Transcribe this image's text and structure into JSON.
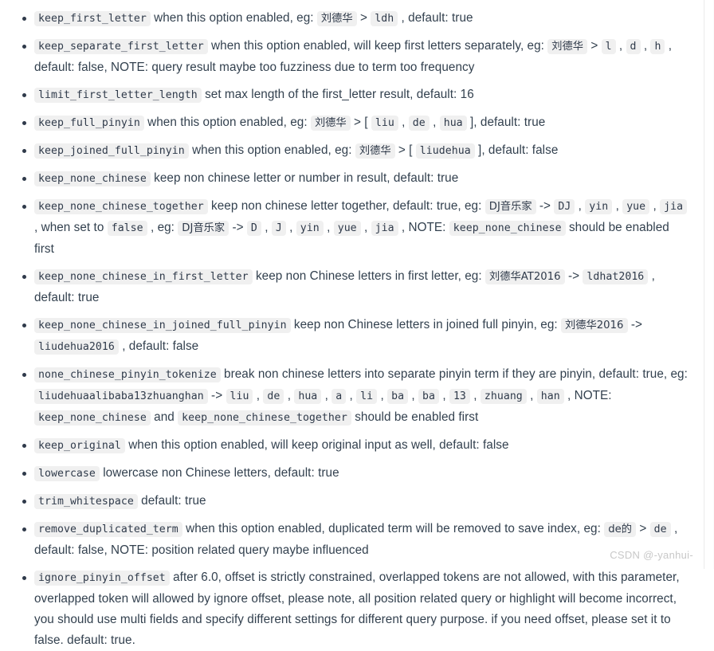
{
  "document": {
    "watermark": "CSDN @-yanhui-",
    "items": [
      {
        "id": "keep_first_letter",
        "name": "keep_first_letter",
        "parts": [
          {
            "t": "text",
            "v": "when this option enabled, eg:"
          },
          {
            "t": "code",
            "v": "刘德华"
          },
          {
            "t": "text",
            "v": ">"
          },
          {
            "t": "code",
            "v": "ldh"
          },
          {
            "t": "text",
            "v": ", default: true"
          }
        ]
      },
      {
        "id": "keep_separate_first_letter",
        "name": "keep_separate_first_letter",
        "parts": [
          {
            "t": "text",
            "v": "when this option enabled, will keep first letters separately, eg:"
          },
          {
            "t": "code",
            "v": "刘德华"
          },
          {
            "t": "text",
            "v": ">"
          },
          {
            "t": "code",
            "v": "l"
          },
          {
            "t": "text",
            "v": ","
          },
          {
            "t": "code",
            "v": "d"
          },
          {
            "t": "text",
            "v": ","
          },
          {
            "t": "code",
            "v": "h"
          },
          {
            "t": "text",
            "v": ", default: false, NOTE: query result maybe too fuzziness due to term too frequency"
          }
        ]
      },
      {
        "id": "limit_first_letter_length",
        "name": "limit_first_letter_length",
        "parts": [
          {
            "t": "text",
            "v": "set max length of the first_letter result, default: 16"
          }
        ]
      },
      {
        "id": "keep_full_pinyin",
        "name": "keep_full_pinyin",
        "parts": [
          {
            "t": "text",
            "v": "when this option enabled, eg:"
          },
          {
            "t": "code",
            "v": "刘德华"
          },
          {
            "t": "text",
            "v": "> ["
          },
          {
            "t": "code",
            "v": "liu"
          },
          {
            "t": "text",
            "v": ","
          },
          {
            "t": "code",
            "v": "de"
          },
          {
            "t": "text",
            "v": ","
          },
          {
            "t": "code",
            "v": "hua"
          },
          {
            "t": "text",
            "v": "], default: true"
          }
        ]
      },
      {
        "id": "keep_joined_full_pinyin",
        "name": "keep_joined_full_pinyin",
        "parts": [
          {
            "t": "text",
            "v": "when this option enabled, eg:"
          },
          {
            "t": "code",
            "v": "刘德华"
          },
          {
            "t": "text",
            "v": "> ["
          },
          {
            "t": "code",
            "v": "liudehua"
          },
          {
            "t": "text",
            "v": "], default: false"
          }
        ]
      },
      {
        "id": "keep_none_chinese",
        "name": "keep_none_chinese",
        "parts": [
          {
            "t": "text",
            "v": "keep non chinese letter or number in result, default: true"
          }
        ]
      },
      {
        "id": "keep_none_chinese_together",
        "name": "keep_none_chinese_together",
        "parts": [
          {
            "t": "text",
            "v": "keep non chinese letter together, default: true, eg:"
          },
          {
            "t": "code",
            "v": "DJ音乐家"
          },
          {
            "t": "text",
            "v": "->"
          },
          {
            "t": "code",
            "v": "DJ"
          },
          {
            "t": "text",
            "v": ","
          },
          {
            "t": "code",
            "v": "yin"
          },
          {
            "t": "text",
            "v": ","
          },
          {
            "t": "code",
            "v": "yue"
          },
          {
            "t": "text",
            "v": ","
          },
          {
            "t": "code",
            "v": "jia"
          },
          {
            "t": "text",
            "v": ", when set to"
          },
          {
            "t": "code",
            "v": "false"
          },
          {
            "t": "text",
            "v": ", eg:"
          },
          {
            "t": "code",
            "v": "DJ音乐家"
          },
          {
            "t": "text",
            "v": "->"
          },
          {
            "t": "code",
            "v": "D"
          },
          {
            "t": "text",
            "v": ","
          },
          {
            "t": "code",
            "v": "J"
          },
          {
            "t": "text",
            "v": ","
          },
          {
            "t": "code",
            "v": "yin"
          },
          {
            "t": "text",
            "v": ","
          },
          {
            "t": "code",
            "v": "yue"
          },
          {
            "t": "text",
            "v": ","
          },
          {
            "t": "code",
            "v": "jia"
          },
          {
            "t": "text",
            "v": ", NOTE:"
          },
          {
            "t": "code",
            "v": "keep_none_chinese"
          },
          {
            "t": "text",
            "v": "should be enabled first"
          }
        ]
      },
      {
        "id": "keep_none_chinese_in_first_letter",
        "name": "keep_none_chinese_in_first_letter",
        "parts": [
          {
            "t": "text",
            "v": "keep non Chinese letters in first letter, eg:"
          },
          {
            "t": "code",
            "v": "刘德华AT2016"
          },
          {
            "t": "text",
            "v": "->"
          },
          {
            "t": "code",
            "v": "ldhat2016"
          },
          {
            "t": "text",
            "v": ", default: true"
          }
        ]
      },
      {
        "id": "keep_none_chinese_in_joined_full_pinyin",
        "name": "keep_none_chinese_in_joined_full_pinyin",
        "parts": [
          {
            "t": "text",
            "v": "keep non Chinese letters in joined full pinyin, eg:"
          },
          {
            "t": "code",
            "v": "刘德华2016"
          },
          {
            "t": "text",
            "v": "->"
          },
          {
            "t": "code",
            "v": "liudehua2016"
          },
          {
            "t": "text",
            "v": ", default: false"
          }
        ]
      },
      {
        "id": "none_chinese_pinyin_tokenize",
        "name": "none_chinese_pinyin_tokenize",
        "parts": [
          {
            "t": "text",
            "v": "break non chinese letters into separate pinyin term if they are pinyin, default: true, eg:"
          },
          {
            "t": "code",
            "v": "liudehuaalibaba13zhuanghan"
          },
          {
            "t": "text",
            "v": "->"
          },
          {
            "t": "code",
            "v": "liu"
          },
          {
            "t": "text",
            "v": ","
          },
          {
            "t": "code",
            "v": "de"
          },
          {
            "t": "text",
            "v": ","
          },
          {
            "t": "code",
            "v": "hua"
          },
          {
            "t": "text",
            "v": ","
          },
          {
            "t": "code",
            "v": "a"
          },
          {
            "t": "text",
            "v": ","
          },
          {
            "t": "code",
            "v": "li"
          },
          {
            "t": "text",
            "v": ","
          },
          {
            "t": "code",
            "v": "ba"
          },
          {
            "t": "text",
            "v": ","
          },
          {
            "t": "code",
            "v": "ba"
          },
          {
            "t": "text",
            "v": ","
          },
          {
            "t": "code",
            "v": "13"
          },
          {
            "t": "text",
            "v": ","
          },
          {
            "t": "code",
            "v": "zhuang"
          },
          {
            "t": "text",
            "v": ","
          },
          {
            "t": "code",
            "v": "han"
          },
          {
            "t": "text",
            "v": ", NOTE:"
          },
          {
            "t": "code",
            "v": "keep_none_chinese"
          },
          {
            "t": "text",
            "v": "and"
          },
          {
            "t": "code",
            "v": "keep_none_chinese_together"
          },
          {
            "t": "text",
            "v": "should be enabled first"
          }
        ]
      },
      {
        "id": "keep_original",
        "name": "keep_original",
        "parts": [
          {
            "t": "text",
            "v": "when this option enabled, will keep original input as well, default: false"
          }
        ]
      },
      {
        "id": "lowercase",
        "name": "lowercase",
        "parts": [
          {
            "t": "text",
            "v": "lowercase non Chinese letters, default: true"
          }
        ]
      },
      {
        "id": "trim_whitespace",
        "name": "trim_whitespace",
        "parts": [
          {
            "t": "text",
            "v": "default: true"
          }
        ]
      },
      {
        "id": "remove_duplicated_term",
        "name": "remove_duplicated_term",
        "parts": [
          {
            "t": "text",
            "v": "when this option enabled, duplicated term will be removed to save index, eg:"
          },
          {
            "t": "code",
            "v": "de的"
          },
          {
            "t": "text",
            "v": ">"
          },
          {
            "t": "code",
            "v": "de"
          },
          {
            "t": "text",
            "v": ", default: false, NOTE: position related query maybe influenced"
          }
        ]
      },
      {
        "id": "ignore_pinyin_offset",
        "name": "ignore_pinyin_offset",
        "parts": [
          {
            "t": "text",
            "v": "after 6.0, offset is strictly constrained, overlapped tokens are not allowed, with this parameter, overlapped token will allowed by ignore offset, please note, all position related query or highlight will become incorrect, you should use multi fields and specify different settings for different query purpose. if you need offset, please set it to false. default: true."
          }
        ]
      }
    ]
  }
}
